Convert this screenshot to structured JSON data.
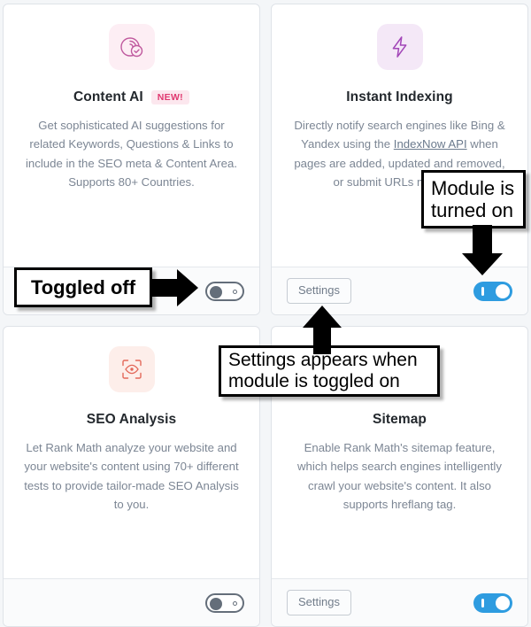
{
  "theme": {
    "page_bg": "#f4f6f8",
    "card_bg": "#ffffff",
    "footer_bg": "#fafbfc",
    "border": "#dfe3e8",
    "title_color": "#23282d",
    "desc_color": "#7c8694",
    "toggle_on_color": "#2e9ce0",
    "toggle_off_color": "#646e7a",
    "badge_bg": "#fce7ee",
    "badge_text": "#e0386f",
    "annotation_color": "#000000"
  },
  "cards": [
    {
      "id": "content-ai",
      "icon_name": "content-ai-icon",
      "icon_bg": "#fdeef4",
      "title": "Content AI",
      "badge": "NEW!",
      "description": "Get sophisticated AI suggestions for related Keywords, Questions & Links to include in the SEO meta & Content Area. Supports 80+ Countries.",
      "has_settings": false,
      "settings_label": "Settings",
      "toggle_state": "off"
    },
    {
      "id": "instant-indexing",
      "icon_name": "lightning-bolt-icon",
      "icon_bg": "#f4e8f7",
      "title": "Instant Indexing",
      "badge": null,
      "description_parts": {
        "before": "Directly notify search engines like Bing & Yandex using the ",
        "link": "IndexNow API",
        "after": " when pages are added, updated and removed, or submit URLs manually."
      },
      "has_settings": true,
      "settings_label": "Settings",
      "toggle_state": "on"
    },
    {
      "id": "seo-analysis",
      "icon_name": "eye-scan-icon",
      "icon_bg": "#fdeeea",
      "title": "SEO Analysis",
      "badge": null,
      "description": "Let Rank Math analyze your website and your website's content using 70+ different tests to provide tailor-made SEO Analysis to you.",
      "has_settings": false,
      "settings_label": "Settings",
      "toggle_state": "off"
    },
    {
      "id": "sitemap",
      "icon_name": "sitemap-icon",
      "icon_bg": "#fdf0e6",
      "title": "Sitemap",
      "badge": null,
      "description": "Enable Rank Math's sitemap feature, which helps search engines intelligently crawl your website's content. It also supports hreflang tag.",
      "has_settings": true,
      "settings_label": "Settings",
      "toggle_state": "on"
    }
  ],
  "annotations": [
    {
      "id": "toggled-off",
      "text": "Toggled off",
      "arrow": "arrow-right-icon"
    },
    {
      "id": "module-on",
      "text": "Module is turned on",
      "arrow": "arrow-down-icon"
    },
    {
      "id": "settings-appears",
      "text": "Settings appears when module is toggled on",
      "arrow": "arrow-up-icon"
    }
  ]
}
